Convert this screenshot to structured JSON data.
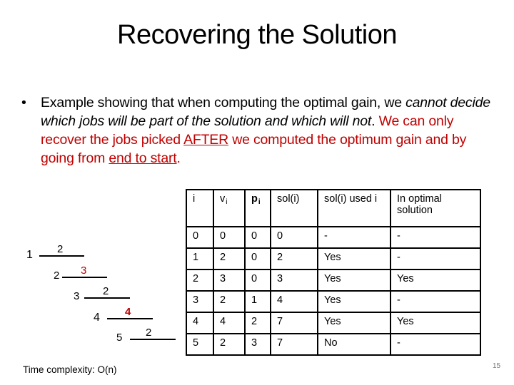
{
  "slide": {
    "title": "Recovering the Solution",
    "bullet": {
      "marker": "•",
      "part1": "Example showing that when computing the optimal gain, we ",
      "part2_italic": "cannot decide which jobs will be part of the solution and which will not",
      "part3": ". ",
      "part4_red": "We can only recover the jobs picked ",
      "part5_red_underline": "AFTER",
      "part6_red": " we computed the optimum gain and by going from ",
      "part7_red_underline": "end to start",
      "part8_red": "."
    },
    "footer": "Time complexity: O(n)",
    "page_number": "15"
  },
  "diagram": {
    "jobs": [
      {
        "index": "1",
        "value": "2",
        "highlight": false
      },
      {
        "index": "2",
        "value": "3",
        "highlight": true
      },
      {
        "index": "3",
        "value": "2",
        "highlight": false
      },
      {
        "index": "4",
        "value": "4",
        "highlight": true
      },
      {
        "index": "5",
        "value": "2",
        "highlight": false
      }
    ],
    "highlight_color": "#c00000"
  },
  "table": {
    "headers": {
      "i": "i",
      "v": "v",
      "v_sub": "i",
      "p": "p",
      "p_sub": "i",
      "sol": "sol(i)",
      "used": "sol(i) used i",
      "optimal": "In optimal solution"
    },
    "rows": [
      {
        "i": "0",
        "v": "0",
        "p": "0",
        "sol": "0",
        "used": "-",
        "optimal": "-"
      },
      {
        "i": "1",
        "v": "2",
        "p": "0",
        "sol": "2",
        "used": "Yes",
        "optimal": "-"
      },
      {
        "i": "2",
        "v": "3",
        "p": "0",
        "sol": "3",
        "used": "Yes",
        "optimal": "Yes"
      },
      {
        "i": "3",
        "v": "2",
        "p": "1",
        "sol": "4",
        "used": "Yes",
        "optimal": "-"
      },
      {
        "i": "4",
        "v": "4",
        "p": "2",
        "sol": "7",
        "used": "Yes",
        "optimal": "Yes"
      },
      {
        "i": "5",
        "v": "2",
        "p": "3",
        "sol": "7",
        "used": "No",
        "optimal": "-"
      }
    ]
  }
}
